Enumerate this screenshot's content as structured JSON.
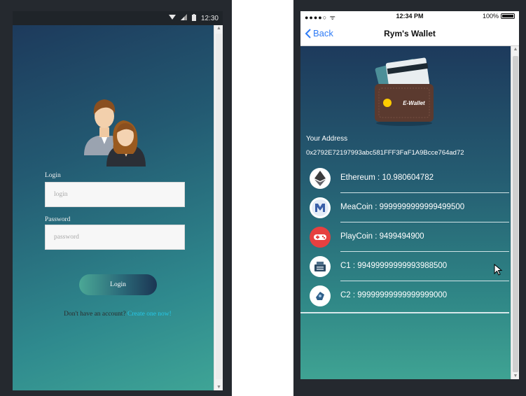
{
  "login_screen": {
    "status_time": "12:30",
    "login_label": "Login",
    "login_placeholder": "login",
    "password_label": "Password",
    "password_placeholder": "password",
    "login_button": "Login",
    "signup_prompt": "Don't have an account?",
    "signup_link": "Create one now!"
  },
  "wallet_screen": {
    "status": {
      "carrier": "●●●●○ ᯤ",
      "time": "12:34 PM",
      "battery": "100%"
    },
    "nav": {
      "back_label": "Back",
      "title": "Rym's Wallet"
    },
    "wallet_badge": "E-Wallet",
    "address_label": "Your Address",
    "address_value": "0x2792E72197993abc581FFF3FaF1A9Bcce764ad72",
    "coins": [
      {
        "text": "Ethereum : 10.980604782",
        "icon": "ethereum-icon"
      },
      {
        "text": "MeaCoin : 9999999999999499500",
        "icon": "meacoin-icon"
      },
      {
        "text": "PlayCoin : 9499494900",
        "icon": "playcoin-icon"
      },
      {
        "text": "C1 : 99499999999993988500",
        "icon": "c1-icon"
      },
      {
        "text": "C2 : 99999999999999999000",
        "icon": "c2-icon"
      }
    ]
  },
  "colors": {
    "gradient_dark": "#1d3a5c",
    "gradient_light": "#3fa596",
    "link": "#25c8e8",
    "ios_blue": "#2f7cf6"
  }
}
